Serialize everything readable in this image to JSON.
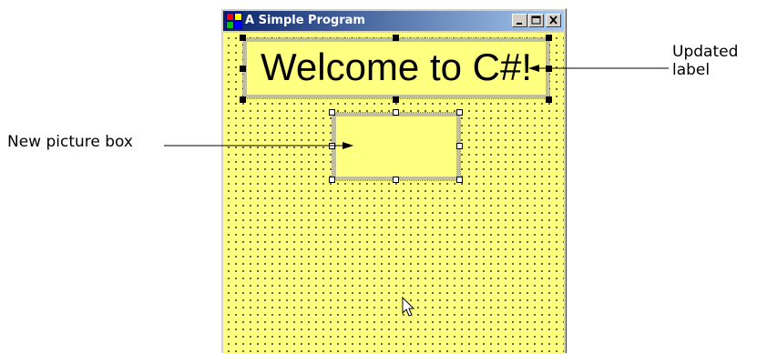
{
  "window": {
    "title": "A Simple Program",
    "icon": "app-form-icon",
    "controls": [
      "minimize-icon",
      "maximize-icon",
      "close-icon"
    ]
  },
  "form": {
    "background_color": "#ffff80",
    "grid": "dotted"
  },
  "label_control": {
    "text": "Welcome to C#!",
    "selected": true
  },
  "picture_box": {
    "selected": true
  },
  "callouts": {
    "updated_label_line1": "Updated",
    "updated_label_line2": "label",
    "new_picture_box": "New picture box"
  },
  "cursor": "arrow-cursor-icon"
}
